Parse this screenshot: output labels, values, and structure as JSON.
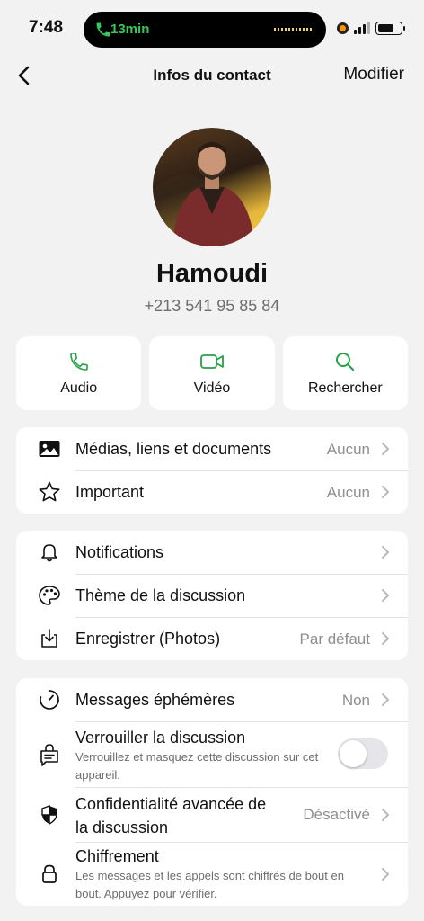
{
  "status": {
    "time": "7:48",
    "call_duration": "13min"
  },
  "nav": {
    "title": "Infos du contact",
    "edit_label": "Modifier"
  },
  "contact": {
    "name": "Hamoudi",
    "phone": "+213 541 95 85 84"
  },
  "actions": [
    {
      "label": "Audio",
      "icon": "phone-icon"
    },
    {
      "label": "Vidéo",
      "icon": "video-icon"
    },
    {
      "label": "Rechercher",
      "icon": "search-icon"
    }
  ],
  "group1": [
    {
      "label": "Médias, liens et documents",
      "value": "Aucun",
      "icon": "photo-icon"
    },
    {
      "label": "Important",
      "value": "Aucun",
      "icon": "star-icon"
    }
  ],
  "group2": [
    {
      "label": "Notifications",
      "icon": "bell-icon"
    },
    {
      "label": "Thème de la discussion",
      "icon": "palette-icon"
    },
    {
      "label": "Enregistrer (Photos)",
      "value": "Par défaut",
      "icon": "save-icon"
    }
  ],
  "group3": {
    "disappearing": {
      "label": "Messages éphémères",
      "value": "Non",
      "icon": "timer-icon"
    },
    "lock": {
      "label": "Verrouiller la discussion",
      "sub": "Verrouillez et masquez cette discussion sur cet appareil.",
      "toggle_on": false,
      "icon": "chat-lock-icon"
    },
    "privacy": {
      "label_line1": "Confidentialité avancée de",
      "label_line2": "la discussion",
      "value": "Désactivé",
      "icon": "shield-icon"
    },
    "encryption": {
      "label": "Chiffrement",
      "sub": "Les messages et les appels sont chiffrés de bout en bout. Appuyez pour vérifier.",
      "icon": "lock-icon"
    }
  },
  "colors": {
    "accent": "#25a244",
    "background": "#f2f2f2",
    "card": "#ffffff",
    "secondary_text": "#8e8e93"
  }
}
